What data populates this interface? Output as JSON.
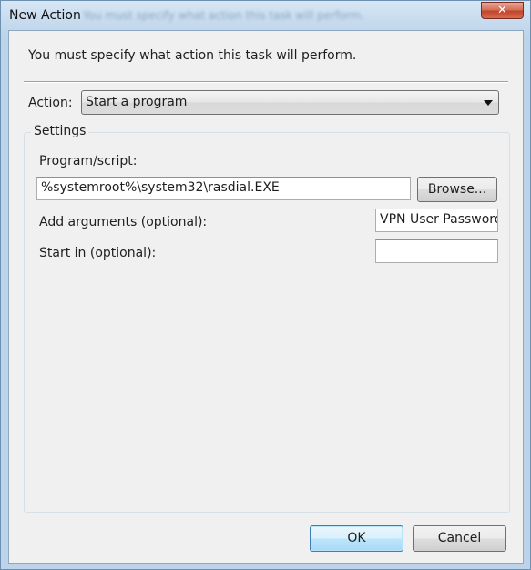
{
  "window": {
    "title": "New Action",
    "close_glyph": "✕"
  },
  "instruction": "You must specify what action this task will perform.",
  "action": {
    "label": "Action:",
    "selected": "Start a program"
  },
  "settings": {
    "legend": "Settings",
    "program_label": "Program/script:",
    "program_value": "%systemroot%\\system32\\rasdial.EXE",
    "browse_label": "Browse...",
    "arguments_label": "Add arguments (optional):",
    "arguments_value": "VPN User Password",
    "start_in_label": "Start in (optional):",
    "start_in_value": ""
  },
  "buttons": {
    "ok": "OK",
    "cancel": "Cancel"
  },
  "icons": {
    "close": "close-icon",
    "dropdown": "chevron-down-icon"
  }
}
